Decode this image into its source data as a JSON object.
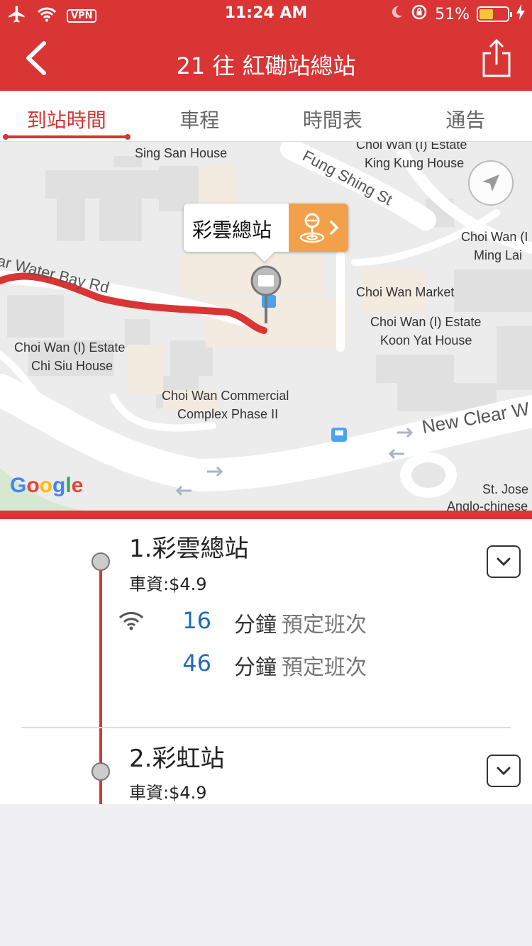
{
  "status_bar": {
    "time": "11:24 AM",
    "vpn_label": "VPN",
    "battery_percent": "51%",
    "battery_level": 0.51,
    "icons": [
      "airplane-icon",
      "wifi-icon",
      "moon-icon",
      "rotation-lock-icon",
      "charging-icon"
    ]
  },
  "header": {
    "title": "21 往 紅磡站總站",
    "back_icon": "chevron-left-icon",
    "share_icon": "share-icon"
  },
  "tabs": [
    {
      "label": "到站時間",
      "active": true
    },
    {
      "label": "車程",
      "active": false
    },
    {
      "label": "時間表",
      "active": false
    },
    {
      "label": "通告",
      "active": false
    }
  ],
  "map": {
    "labels": {
      "sing_san": "Sing San House",
      "choi_wan_estate_top": "Choi Wan (I) Estate",
      "king_kung": "King Kung House",
      "fung_shing": "Fung Shing St",
      "choi_wan_ming_1": "Choi Wan (I",
      "choi_wan_ming_2": "Ming Lai",
      "clear_water_bay": "ar Water Bay Rd",
      "market": "Choi Wan Market",
      "koon_yat_1": "Choi Wan (I) Estate",
      "koon_yat_2": "Koon Yat House",
      "chi_siu_1": "Choi Wan (I) Estate",
      "chi_siu_2": "Chi Siu House",
      "commercial_1": "Choi Wan Commercial",
      "commercial_2": "Complex Phase II",
      "new_clear": "New Clear W",
      "st_jose_1": "St. Jose",
      "st_jose_2": "Anglo-chinese"
    },
    "callout_text": "彩雲總站",
    "google_logo": "Google",
    "colors": {
      "route": "#d93535",
      "callout_button": "#f2a14a"
    }
  },
  "stops": [
    {
      "name": "1.彩雲總站",
      "fare": "車資:$4.9",
      "etas": [
        {
          "minutes": "16",
          "unit": "分鐘",
          "note": "預定班次",
          "realtime_icon": true
        },
        {
          "minutes": "46",
          "unit": "分鐘",
          "note": "預定班次",
          "realtime_icon": false
        }
      ]
    },
    {
      "name": "2.彩虹站",
      "fare": "車資:$4.9",
      "etas": []
    }
  ],
  "colors": {
    "brand": "#d93535",
    "eta_number": "#1f6bb8"
  }
}
